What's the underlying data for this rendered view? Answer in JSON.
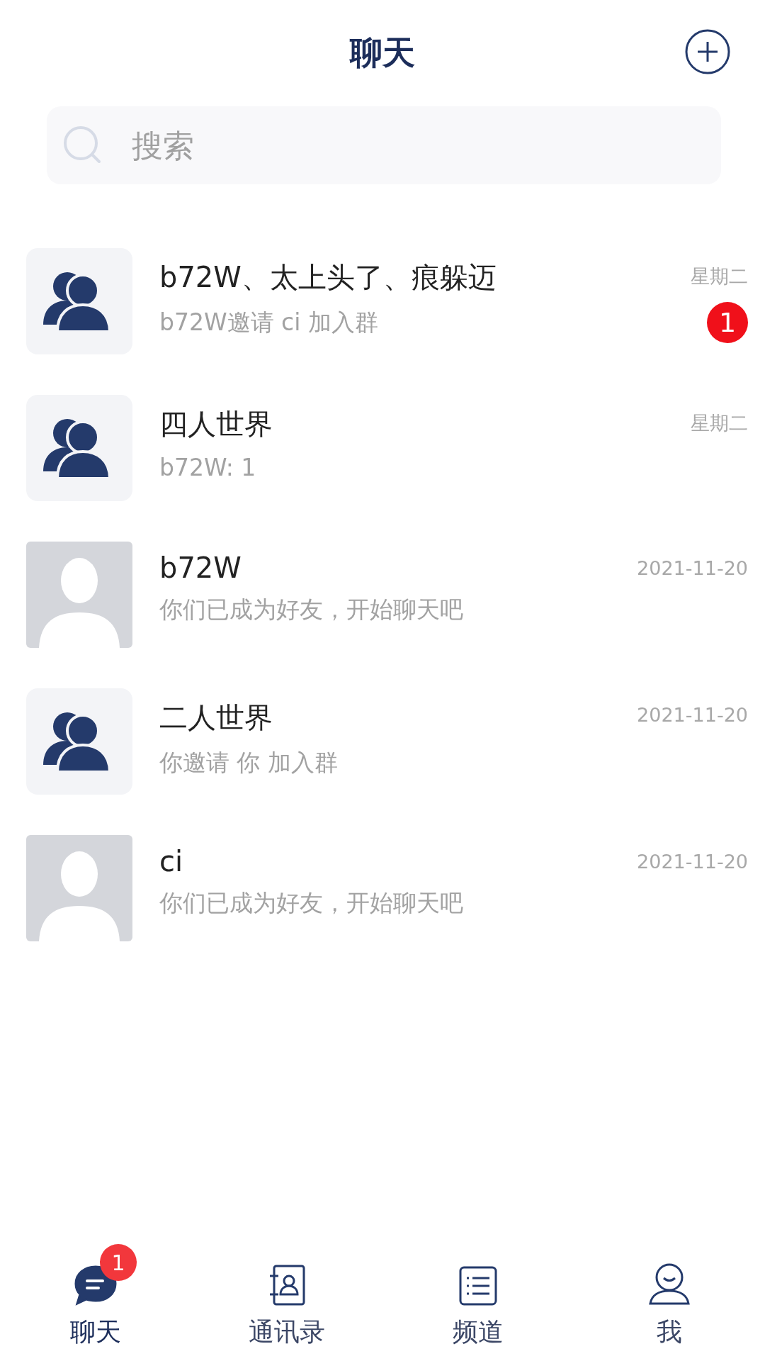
{
  "header": {
    "title": "聊天"
  },
  "search": {
    "placeholder": "搜索"
  },
  "chats": [
    {
      "kind": "group",
      "name": "b72W、太上头了、痕躲迈",
      "preview": "b72W邀请 ci 加入群",
      "time": "星期二",
      "unread": "1"
    },
    {
      "kind": "group",
      "name": "四人世界",
      "preview": "b72W: 1",
      "time": "星期二"
    },
    {
      "kind": "person",
      "name": "b72W",
      "preview": "你们已成为好友，开始聊天吧",
      "time": "2021-11-20"
    },
    {
      "kind": "group",
      "name": "二人世界",
      "preview": "你邀请 你 加入群",
      "time": "2021-11-20"
    },
    {
      "kind": "person",
      "name": "ci",
      "preview": "你们已成为好友，开始聊天吧",
      "time": "2021-11-20"
    }
  ],
  "tabs": [
    {
      "kind": "chat",
      "label": "聊天",
      "selected": true,
      "badge": "1"
    },
    {
      "kind": "contacts",
      "label": "通讯录",
      "selected": false
    },
    {
      "kind": "channels",
      "label": "频道",
      "selected": false
    },
    {
      "kind": "me",
      "label": "我",
      "selected": false
    }
  ]
}
